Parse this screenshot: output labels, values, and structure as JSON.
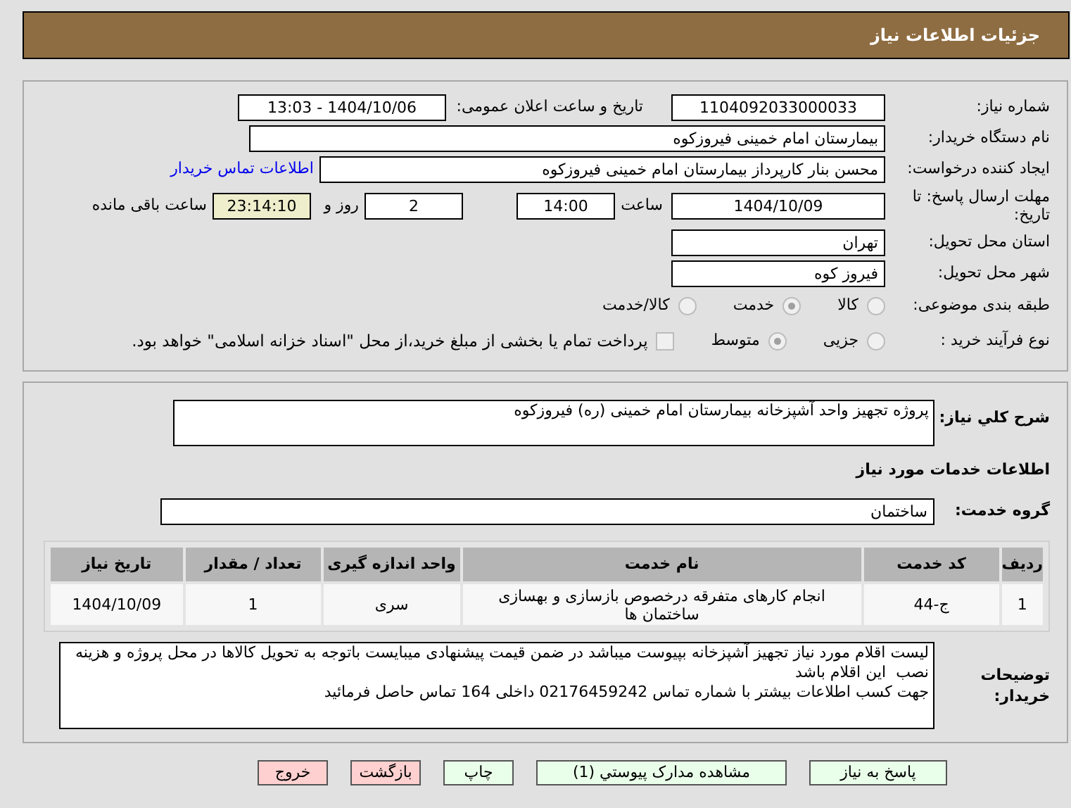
{
  "header": {
    "title": "جزئیات اطلاعات نیاز"
  },
  "need_number": {
    "label": "شماره نیاز:",
    "value": "1104092033000033"
  },
  "announce": {
    "label": "تاریخ و ساعت اعلان عمومی:",
    "value": "1404/10/06 - 13:03"
  },
  "buyer_org": {
    "label": "نام دستگاه خریدار:",
    "value": "بیمارستان امام خمینی فیروزکوه"
  },
  "requester": {
    "label": "ایجاد کننده درخواست:",
    "value": "محسن بنار کارپرداز بیمارستان امام خمینی فیروزکوه",
    "link": "اطلاعات تماس خریدار"
  },
  "deadline": {
    "label": "مهلت ارسال پاسخ: تا تاریخ:",
    "date": "1404/10/09",
    "time_label": "ساعت",
    "time": "14:00",
    "days": "2",
    "days_label": "روز و",
    "remaining": "23:14:10",
    "remaining_label": "ساعت باقی مانده"
  },
  "province": {
    "label": "استان محل تحویل:",
    "value": "تهران"
  },
  "city": {
    "label": "شهر محل تحویل:",
    "value": "فیروز کوه"
  },
  "category": {
    "label": "طبقه بندی موضوعی:",
    "options": [
      {
        "label": "کالا",
        "selected": false
      },
      {
        "label": "خدمت",
        "selected": true
      },
      {
        "label": "کالا/خدمت",
        "selected": false
      }
    ]
  },
  "process": {
    "label": "نوع فرآیند خرید :",
    "options": [
      {
        "label": "جزیی",
        "selected": false
      },
      {
        "label": "متوسط",
        "selected": true
      }
    ],
    "treasury": {
      "checked": false,
      "label": "پرداخت تمام یا بخشی از مبلغ خرید،از محل \"اسناد خزانه اسلامی\" خواهد بود."
    }
  },
  "description": {
    "label": "شرح کلي نیاز:",
    "value": "پروژه تجهیز واحد آشپزخانه بیمارستان امام خمینی (ره) فیروزکوه"
  },
  "services_heading": "اطلاعات خدمات مورد نیاز",
  "service_group": {
    "label": "گروه خدمت:",
    "value": "ساختمان"
  },
  "table": {
    "columns": [
      "ردیف",
      "کد خدمت",
      "نام خدمت",
      "واحد اندازه گیری",
      "تعداد / مقدار",
      "تاریخ نیاز"
    ],
    "rows": [
      [
        "1",
        "ج-44",
        "انجام کارهای متفرقه درخصوص بازسازی و بهسازی ساختمان ها",
        "سری",
        "1",
        "1404/10/09"
      ]
    ]
  },
  "buyer_notes": {
    "label": "توضیحات خریدار:",
    "value": "لیست اقلام مورد نیاز تجهیز آشپزخانه بپیوست میباشد در ضمن قیمت پیشنهادی میبایست باتوجه به تحویل کالاها در محل پروژه و هزینه نصب  این اقلام باشد\nجهت کسب اطلاعات بیشتر با شماره تماس 02176459242 داخلی 164 تماس حاصل فرمائید"
  },
  "buttons": [
    {
      "label": "پاسخ به نیاز",
      "kind": "normal"
    },
    {
      "label": "مشاهده مدارک پیوستي (1)",
      "kind": "normal"
    },
    {
      "label": "چاپ",
      "kind": "normal"
    },
    {
      "label": "بازگشت",
      "kind": "danger"
    },
    {
      "label": "خروج",
      "kind": "danger"
    }
  ]
}
